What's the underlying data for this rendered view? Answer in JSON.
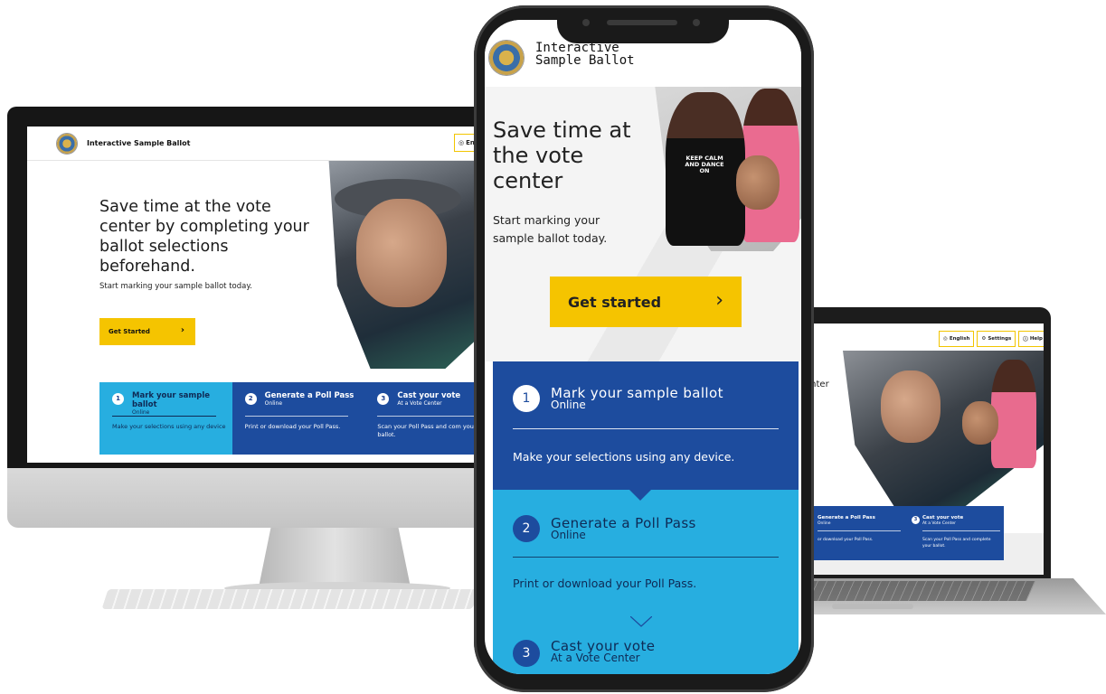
{
  "desktop": {
    "header_title": "Interactive Sample Ballot",
    "language_button": "Englis",
    "hero_heading": "Save time at the vote center by completing your ballot selections beforehand.",
    "hero_subtext": "Start marking your sample ballot today.",
    "cta_label": "Get Started",
    "cta_icon": "chevron-right-icon",
    "steps": [
      {
        "number": "1",
        "title": "Mark your sample ballot",
        "subtitle": "Online",
        "description": "Make your selections using any device",
        "color": "#27aee0"
      },
      {
        "number": "2",
        "title": "Generate a Poll Pass",
        "subtitle": "Online",
        "description": "Print or download your Poll Pass.",
        "color": "#1d4c9e"
      },
      {
        "number": "3",
        "title": "Cast your vote",
        "subtitle": "At a Vote Center",
        "description": "Scan your Poll Pass and com your ballot.",
        "color": "#1d4c9e"
      }
    ]
  },
  "phone": {
    "header_title": "Interactive Sample Ballot",
    "hero_heading": "Save time at the vote center",
    "hero_subtext": "Start marking your sample ballot today.",
    "hero_slogan": "KEEP CALM AND DANCE ON",
    "cta_label": "Get started",
    "cta_icon": "chevron-right-icon",
    "steps": [
      {
        "number": "1",
        "title": "Mark your sample ballot",
        "subtitle": "Online",
        "description": "Make your selections using any device."
      },
      {
        "number": "2",
        "title": "Generate a Poll Pass",
        "subtitle": "Online",
        "description": "Print or download your Poll Pass."
      },
      {
        "number": "3",
        "title": "Cast your vote",
        "subtitle": "At a Vote Center"
      }
    ]
  },
  "laptop": {
    "buttons": [
      {
        "label": "English",
        "icon": "globe-icon"
      },
      {
        "label": "Settings",
        "icon": "gear-icon"
      },
      {
        "label": "Help",
        "icon": "help-icon"
      }
    ],
    "hero_fragment_line1": "enter",
    "hero_fragment_line2": "ot",
    "steps": [
      {
        "number": "",
        "title": "Generate a Poll Pass",
        "subtitle": "Online",
        "description": "or download your Poll Pass."
      },
      {
        "number": "3",
        "title": "Cast your vote",
        "subtitle": "At a Vote Center",
        "description": "Scan your Poll Pass and complete your ballot."
      }
    ]
  },
  "colors": {
    "accent_yellow": "#f5c400",
    "navy": "#1d4c9e",
    "sky_blue": "#27aee0"
  }
}
